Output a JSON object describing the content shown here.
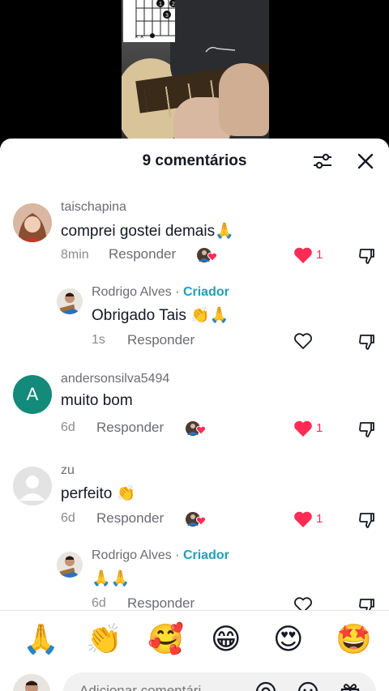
{
  "video": {
    "chord_marks": [
      "1",
      "2",
      "3"
    ],
    "chord_bottom": "× ×"
  },
  "sheet": {
    "title": "9 comentários"
  },
  "comments": [
    {
      "user": "taischapina",
      "text": "comprei gostei demais🙏",
      "time": "8min",
      "reply": "Responder",
      "likes": "1",
      "liked": true,
      "avatar": "photo-woman",
      "avatar_color": "#c9735a"
    },
    {
      "user": "Rodrigo Alves",
      "creator_sep": " · ",
      "creator": "Criador",
      "text": "Obrigado Tais 👏🙏",
      "time": "1s",
      "reply": "Responder",
      "likes": "",
      "liked": false,
      "avatar": "photo-man"
    },
    {
      "user": "andersonsilva5494",
      "text": "muito bom",
      "time": "6d",
      "reply": "Responder",
      "likes": "1",
      "liked": true,
      "avatar_letter": "A",
      "avatar_color": "#138a7a"
    },
    {
      "user": "zu",
      "text": "perfeito 👏",
      "time": "6d",
      "reply": "Responder",
      "likes": "1",
      "liked": true,
      "avatar": "default-avatar"
    },
    {
      "user": "Rodrigo Alves",
      "creator_sep": " · ",
      "creator": "Criador",
      "text": "🙏🙏",
      "time": "6d",
      "reply": "Responder",
      "likes": "",
      "liked": false,
      "avatar": "photo-man"
    }
  ],
  "emojis": [
    "🙏",
    "👏",
    "🥰",
    "😁",
    "😍",
    "🤩"
  ],
  "input": {
    "placeholder": "Adicionar comentári..."
  },
  "colors": {
    "like_red": "#fe2c55",
    "creator": "#20a0b8",
    "text": "#161823",
    "muted": "#8a8b91"
  }
}
